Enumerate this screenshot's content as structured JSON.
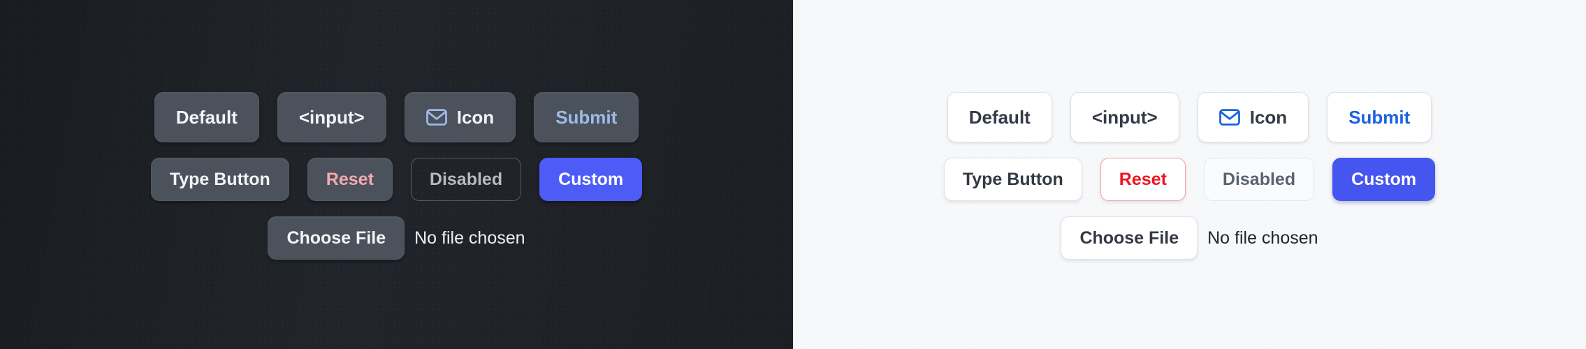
{
  "panels": [
    {
      "theme": "dark",
      "background_color": "#23272d",
      "rows": {
        "row1": [
          {
            "label": "Default",
            "name": "default-button"
          },
          {
            "label": "<input>",
            "name": "input-button"
          },
          {
            "label": "Icon",
            "name": "icon-button",
            "icon": "mail-icon"
          },
          {
            "label": "Submit",
            "name": "submit-button",
            "color": "#9dbbe8"
          }
        ],
        "row2": [
          {
            "label": "Type Button",
            "name": "type-button"
          },
          {
            "label": "Reset",
            "name": "reset-button",
            "color": "#f5a9ae"
          },
          {
            "label": "Disabled",
            "name": "disabled-button",
            "disabled": true
          },
          {
            "label": "Custom",
            "name": "custom-button",
            "color": "#4d5cf6"
          }
        ],
        "row3": {
          "file_button_label": "Choose File",
          "file_status": "No file chosen"
        }
      }
    },
    {
      "theme": "light",
      "background_color": "#f7f8fa",
      "rows": {
        "row1": [
          {
            "label": "Default",
            "name": "default-button"
          },
          {
            "label": "<input>",
            "name": "input-button"
          },
          {
            "label": "Icon",
            "name": "icon-button",
            "icon": "mail-icon"
          },
          {
            "label": "Submit",
            "name": "submit-button",
            "color": "#1a62e0"
          }
        ],
        "row2": [
          {
            "label": "Type Button",
            "name": "type-button"
          },
          {
            "label": "Reset",
            "name": "reset-button",
            "color": "#ee1420"
          },
          {
            "label": "Disabled",
            "name": "disabled-button",
            "disabled": true
          },
          {
            "label": "Custom",
            "name": "custom-button",
            "color": "#4556f0"
          }
        ],
        "row3": {
          "file_button_label": "Choose File",
          "file_status": "No file chosen"
        }
      }
    }
  ]
}
